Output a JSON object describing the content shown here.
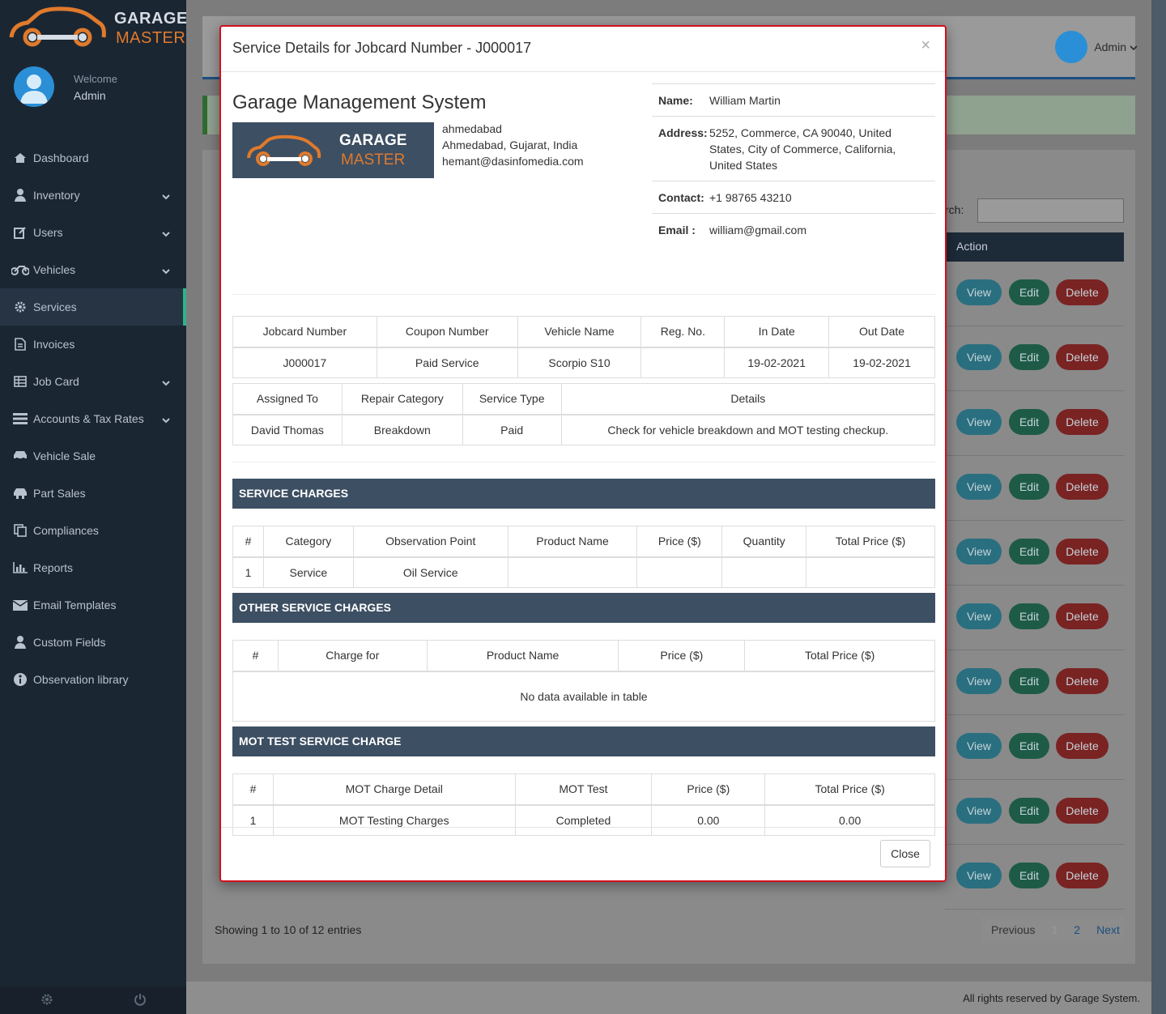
{
  "brand": {
    "line1": "GARAGE",
    "line2": "MASTER"
  },
  "welcome": {
    "label": "Welcome",
    "name": "Admin"
  },
  "nav": [
    {
      "label": "Dashboard",
      "icon": "dashboard-icon",
      "chevron": false
    },
    {
      "label": "Inventory",
      "icon": "user-icon",
      "chevron": true
    },
    {
      "label": "Users",
      "icon": "edit-icon",
      "chevron": true
    },
    {
      "label": "Vehicles",
      "icon": "motorcycle-icon",
      "chevron": true
    },
    {
      "label": "Services",
      "icon": "gear-icon",
      "chevron": false,
      "active": true
    },
    {
      "label": "Invoices",
      "icon": "file-icon",
      "chevron": false
    },
    {
      "label": "Job Card",
      "icon": "table-icon",
      "chevron": true
    },
    {
      "label": "Accounts & Tax Rates",
      "icon": "list-icon",
      "chevron": true
    },
    {
      "label": "Vehicle Sale",
      "icon": "car-icon",
      "chevron": false
    },
    {
      "label": "Part Sales",
      "icon": "parts-icon",
      "chevron": false
    },
    {
      "label": "Compliances",
      "icon": "copy-icon",
      "chevron": false
    },
    {
      "label": "Reports",
      "icon": "bar-chart-icon",
      "chevron": false
    },
    {
      "label": "Email Templates",
      "icon": "envelope-icon",
      "chevron": false
    },
    {
      "label": "Custom Fields",
      "icon": "user-icon",
      "chevron": false
    },
    {
      "label": "Observation library",
      "icon": "info-circle-icon",
      "chevron": false
    }
  ],
  "topbar": {
    "admin": "Admin"
  },
  "background_table": {
    "search_label": "rch:",
    "action_header": "Action",
    "view": "View",
    "edit": "Edit",
    "delete": "Delete",
    "showing": "Showing 1 to 10 of 12 entries",
    "pager": {
      "previous": "Previous",
      "page1": "1",
      "page2": "2",
      "next": "Next"
    }
  },
  "footer": "All rights reserved by Garage System.",
  "modal": {
    "title": "Service Details for Jobcard Number - J000017",
    "close_x": "×",
    "company": {
      "name": "Garage Management System",
      "logo_line1": "GARAGE",
      "logo_line2": "MASTER",
      "addr1": "ahmedabad",
      "addr2": "Ahmedabad, Gujarat, India",
      "email": "hemant@dasinfomedia.com"
    },
    "customer": {
      "name_label": "Name:",
      "name": "William Martin",
      "address_label": "Address:",
      "address_l1": "5252, Commerce, CA 90040, United",
      "address_l2": "States, City of Commerce, California,",
      "address_l3": "United States",
      "contact_label": "Contact:",
      "contact": "+1 98765 43210",
      "email_label": "Email :",
      "email": "william@gmail.com"
    },
    "job_table": {
      "headers": [
        "Jobcard Number",
        "Coupon Number",
        "Vehicle Name",
        "Reg. No.",
        "In Date",
        "Out Date"
      ],
      "row": [
        "J000017",
        "Paid Service",
        "Scorpio S10",
        "",
        "19-02-2021",
        "19-02-2021"
      ]
    },
    "assign_table": {
      "headers": [
        "Assigned To",
        "Repair Category",
        "Service Type",
        "Details"
      ],
      "row": [
        "David Thomas",
        "Breakdown",
        "Paid",
        "Check for vehicle breakdown and MOT testing checkup."
      ]
    },
    "service_charges": {
      "title": "SERVICE CHARGES",
      "headers": [
        "#",
        "Category",
        "Observation Point",
        "Product Name",
        "Price ($)",
        "Quantity",
        "Total Price ($)"
      ],
      "row": [
        "1",
        "Service",
        "Oil Service",
        "",
        "",
        "",
        ""
      ]
    },
    "other_charges": {
      "title": "OTHER SERVICE CHARGES",
      "headers": [
        "#",
        "Charge for",
        "Product Name",
        "Price ($)",
        "Total Price ($)"
      ],
      "empty": "No data available in table"
    },
    "mot_charges": {
      "title": "MOT TEST SERVICE CHARGE",
      "headers": [
        "#",
        "MOT Charge Detail",
        "MOT Test",
        "Price ($)",
        "Total Price ($)"
      ],
      "row": [
        "1",
        "MOT Testing Charges",
        "Completed",
        "0.00",
        "0.00"
      ]
    },
    "close_button": "Close"
  }
}
